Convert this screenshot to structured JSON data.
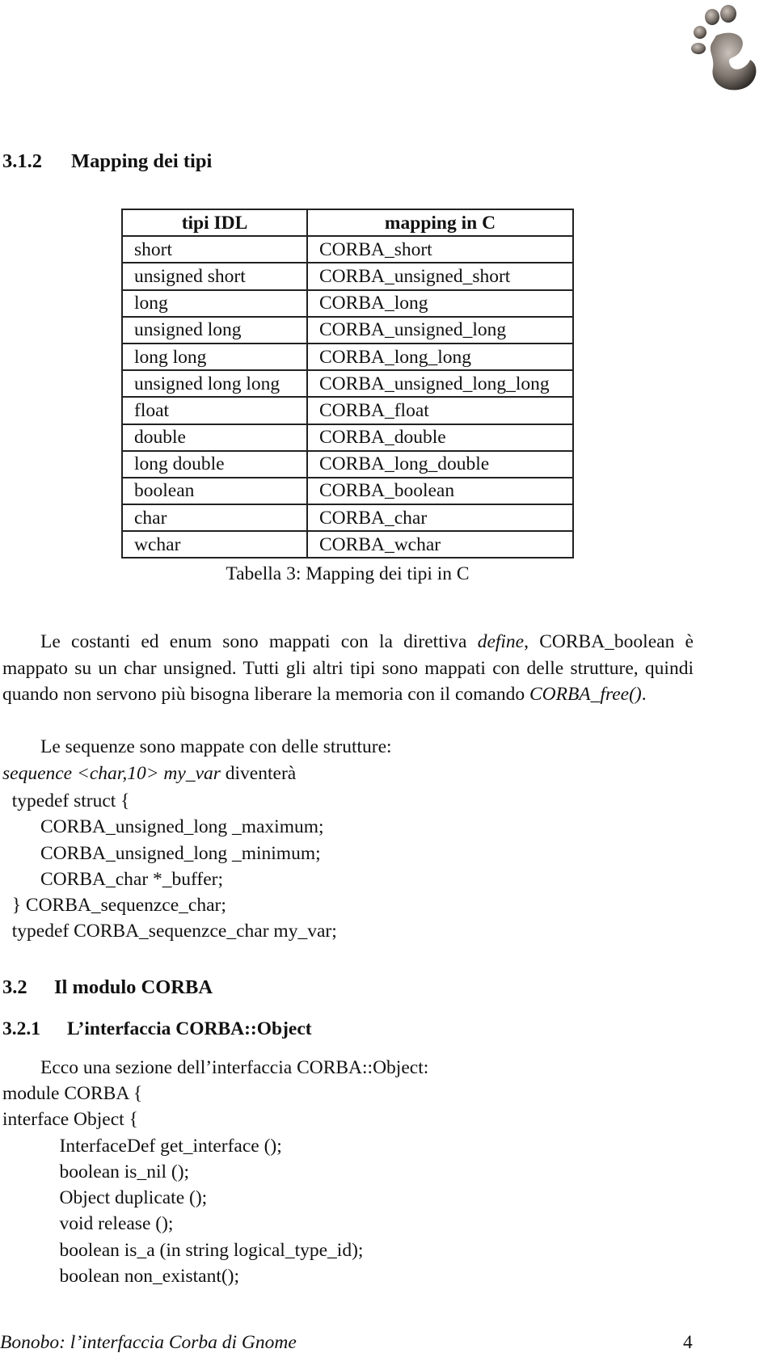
{
  "logo": {
    "icon": "gnome-foot-icon"
  },
  "section_312": {
    "number": "3.1.2",
    "title": "Mapping dei tipi"
  },
  "table": {
    "headers": [
      "tipi IDL",
      "mapping in C"
    ],
    "rows": [
      [
        "short",
        "CORBA_short"
      ],
      [
        "unsigned short",
        "CORBA_unsigned_short"
      ],
      [
        "long",
        "CORBA_long"
      ],
      [
        "unsigned long",
        "CORBA_unsigned_long"
      ],
      [
        "long long",
        "CORBA_long_long"
      ],
      [
        "unsigned long long",
        "CORBA_unsigned_long_long"
      ],
      [
        "float",
        "CORBA_float"
      ],
      [
        "double",
        "CORBA_double"
      ],
      [
        "long double",
        "CORBA_long_double"
      ],
      [
        "boolean",
        "CORBA_boolean"
      ],
      [
        "char",
        "CORBA_char"
      ],
      [
        "wchar",
        "CORBA_wchar"
      ]
    ],
    "caption": "Tabella 3: Mapping dei tipi in C"
  },
  "paragraph1": {
    "part1": "Le costanti ed enum sono mappati con la direttiva ",
    "define": "define",
    "part2": ", CORBA_boolean è mappato su un char unsigned.  Tutti gli altri tipi sono mappati con delle strutture, quindi quando non servono più bisogna liberare la memoria con il comando ",
    "free": "CORBA_free()",
    "part3": "."
  },
  "paragraph2": {
    "text": "Le sequenze sono mappate con delle strutture:",
    "seq_italic": "sequence <char,10> my_var",
    "seq_after": " diventerà"
  },
  "code1": [
    "  typedef struct {",
    "        CORBA_unsigned_long _maximum;",
    "        CORBA_unsigned_long _minimum;",
    "        CORBA_char *_buffer;",
    "  } CORBA_sequenzce_char;",
    "  typedef CORBA_sequenzce_char my_var;"
  ],
  "section_32": {
    "number": "3.2",
    "title": "Il modulo CORBA"
  },
  "section_321": {
    "number": "3.2.1",
    "title": "L’interfaccia CORBA::Object"
  },
  "paragraph3": {
    "text": "Ecco una sezione dell’interfaccia CORBA::Object:"
  },
  "code2": [
    "module CORBA {",
    "interface Object {",
    "            InterfaceDef get_interface ();",
    "            boolean is_nil ();",
    "            Object duplicate ();",
    "            void release ();",
    "            boolean is_a (in string logical_type_id);",
    "            boolean non_existant();"
  ],
  "footer": {
    "title": "Bonobo: l’interfaccia Corba di Gnome",
    "page": "4"
  }
}
